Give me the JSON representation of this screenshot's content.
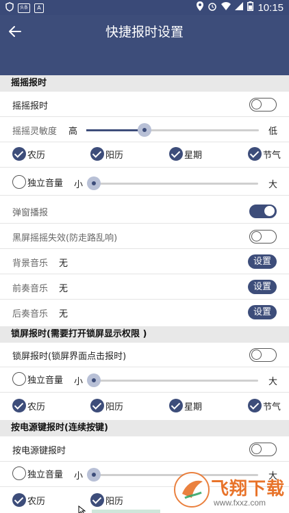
{
  "statusbar": {
    "time": "10:15",
    "icon_box_a": "头条",
    "icon_box_b": "A"
  },
  "header": {
    "title": "快捷报时设置"
  },
  "shake": {
    "section_title": "摇摇报时",
    "toggle_label": "摇摇报时",
    "toggle_on": false,
    "sensitivity_label": "摇摇灵敏度",
    "sensitivity_high": "高",
    "sensitivity_low": "低",
    "sensitivity_value": 0.33,
    "checks": [
      {
        "label": "农历",
        "checked": true
      },
      {
        "label": "阳历",
        "checked": true
      },
      {
        "label": "星期",
        "checked": true
      },
      {
        "label": "节气",
        "checked": true
      }
    ],
    "volume_label": "独立音量",
    "volume_small": "小",
    "volume_large": "大",
    "volume_checked": false,
    "volume_value": 0.0,
    "popup_label": "弹窗播报",
    "popup_on": true,
    "blackscreen_label": "黑屏摇摇失效(防走路乱响)",
    "blackscreen_on": false,
    "bg_music_label": "背景音乐",
    "bg_music_value": "无",
    "prelude_music_label": "前奏音乐",
    "prelude_music_value": "无",
    "post_music_label": "后奏音乐",
    "post_music_value": "无",
    "set_button": "设置"
  },
  "lockscreen": {
    "section_title": "锁屏报时(需要打开锁屏显示权限 )",
    "toggle_label": "锁屏报时(锁屏界面点击报时)",
    "toggle_on": false,
    "volume_label": "独立音量",
    "volume_small": "小",
    "volume_large": "大",
    "volume_checked": false,
    "volume_value": 0.0,
    "checks": [
      {
        "label": "农历",
        "checked": true
      },
      {
        "label": "阳历",
        "checked": true
      },
      {
        "label": "星期",
        "checked": true
      },
      {
        "label": "节气",
        "checked": true
      }
    ]
  },
  "powerkey": {
    "section_title": "按电源键报时(连续按键)",
    "toggle_label": "按电源键报时",
    "toggle_on": false,
    "volume_label": "独立音量",
    "volume_small": "小",
    "volume_large": "大",
    "volume_checked": false,
    "volume_value": 0.0,
    "checks": [
      {
        "label": "农历",
        "checked": true
      },
      {
        "label": "阳历",
        "checked": true
      }
    ]
  },
  "watermark": {
    "text": "飞翔下载",
    "url": "www.fxxz.com"
  },
  "colors": {
    "primary": "#3d4d7a",
    "statusbar": "#3a4a78",
    "section_bg": "#e8e8e8"
  }
}
